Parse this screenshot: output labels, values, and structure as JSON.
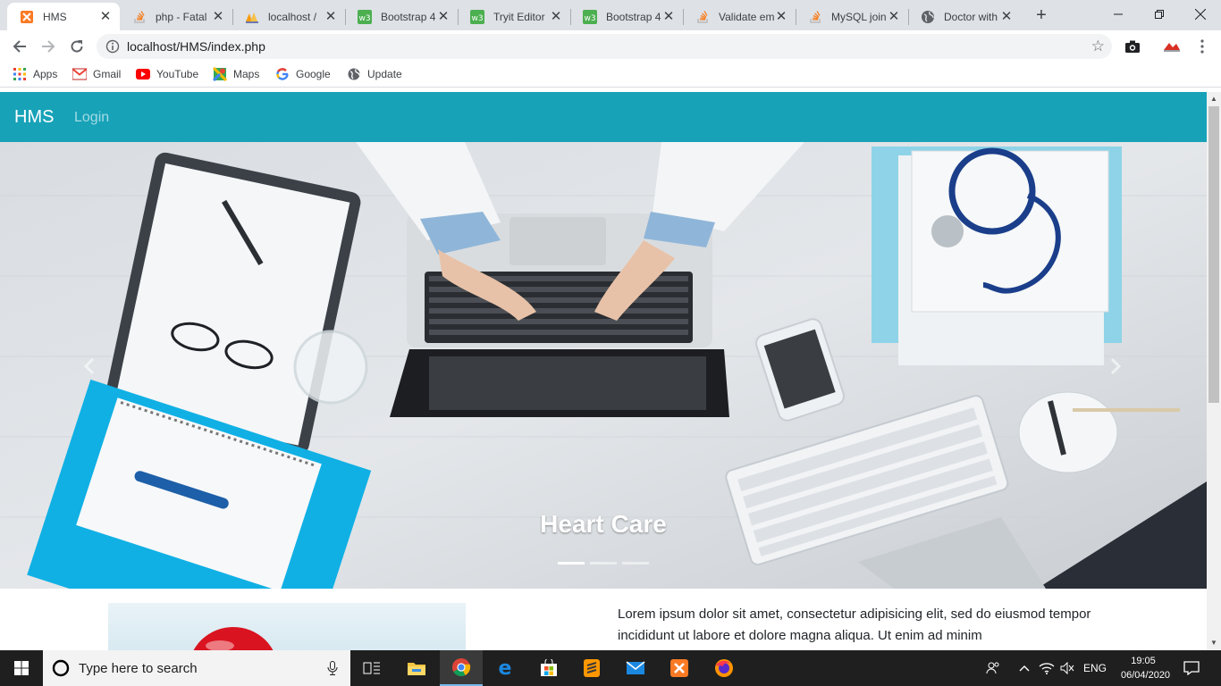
{
  "browser": {
    "tabs": [
      {
        "title": "HMS",
        "active": true,
        "icon": "xampp-icon"
      },
      {
        "title": "php - Fatal",
        "active": false,
        "icon": "stackoverflow-icon"
      },
      {
        "title": "localhost /",
        "active": false,
        "icon": "phpmyadmin-icon"
      },
      {
        "title": "Bootstrap 4",
        "active": false,
        "icon": "w3schools-icon"
      },
      {
        "title": "Tryit Editor",
        "active": false,
        "icon": "w3schools-icon"
      },
      {
        "title": "Bootstrap 4",
        "active": false,
        "icon": "w3schools-icon"
      },
      {
        "title": "Validate em",
        "active": false,
        "icon": "stackoverflow-icon"
      },
      {
        "title": "MySQL join",
        "active": false,
        "icon": "stackoverflow-icon"
      },
      {
        "title": "Doctor with",
        "active": false,
        "icon": "globe-icon"
      }
    ],
    "address": "localhost/HMS/index.php",
    "bookmarks": [
      "Apps",
      "Gmail",
      "YouTube",
      "Maps",
      "Google",
      "Update"
    ]
  },
  "page": {
    "brand": "HMS",
    "nav_login": "Login",
    "carousel": {
      "caption": "Heart Care",
      "indicator_count": 3,
      "active_indicator": 0
    },
    "body_text": "Lorem ipsum dolor sit amet, consectetur adipisicing elit, sed do eiusmod tempor incididunt ut labore et dolore magna aliqua. Ut enim ad minim"
  },
  "taskbar": {
    "search_placeholder": "Type here to search",
    "language": "ENG",
    "time": "19:05",
    "date": "06/04/2020"
  },
  "colors": {
    "navbar": "#17a2b8",
    "tabstrip": "#dee1e6",
    "taskbar": "#1f1f1f"
  }
}
